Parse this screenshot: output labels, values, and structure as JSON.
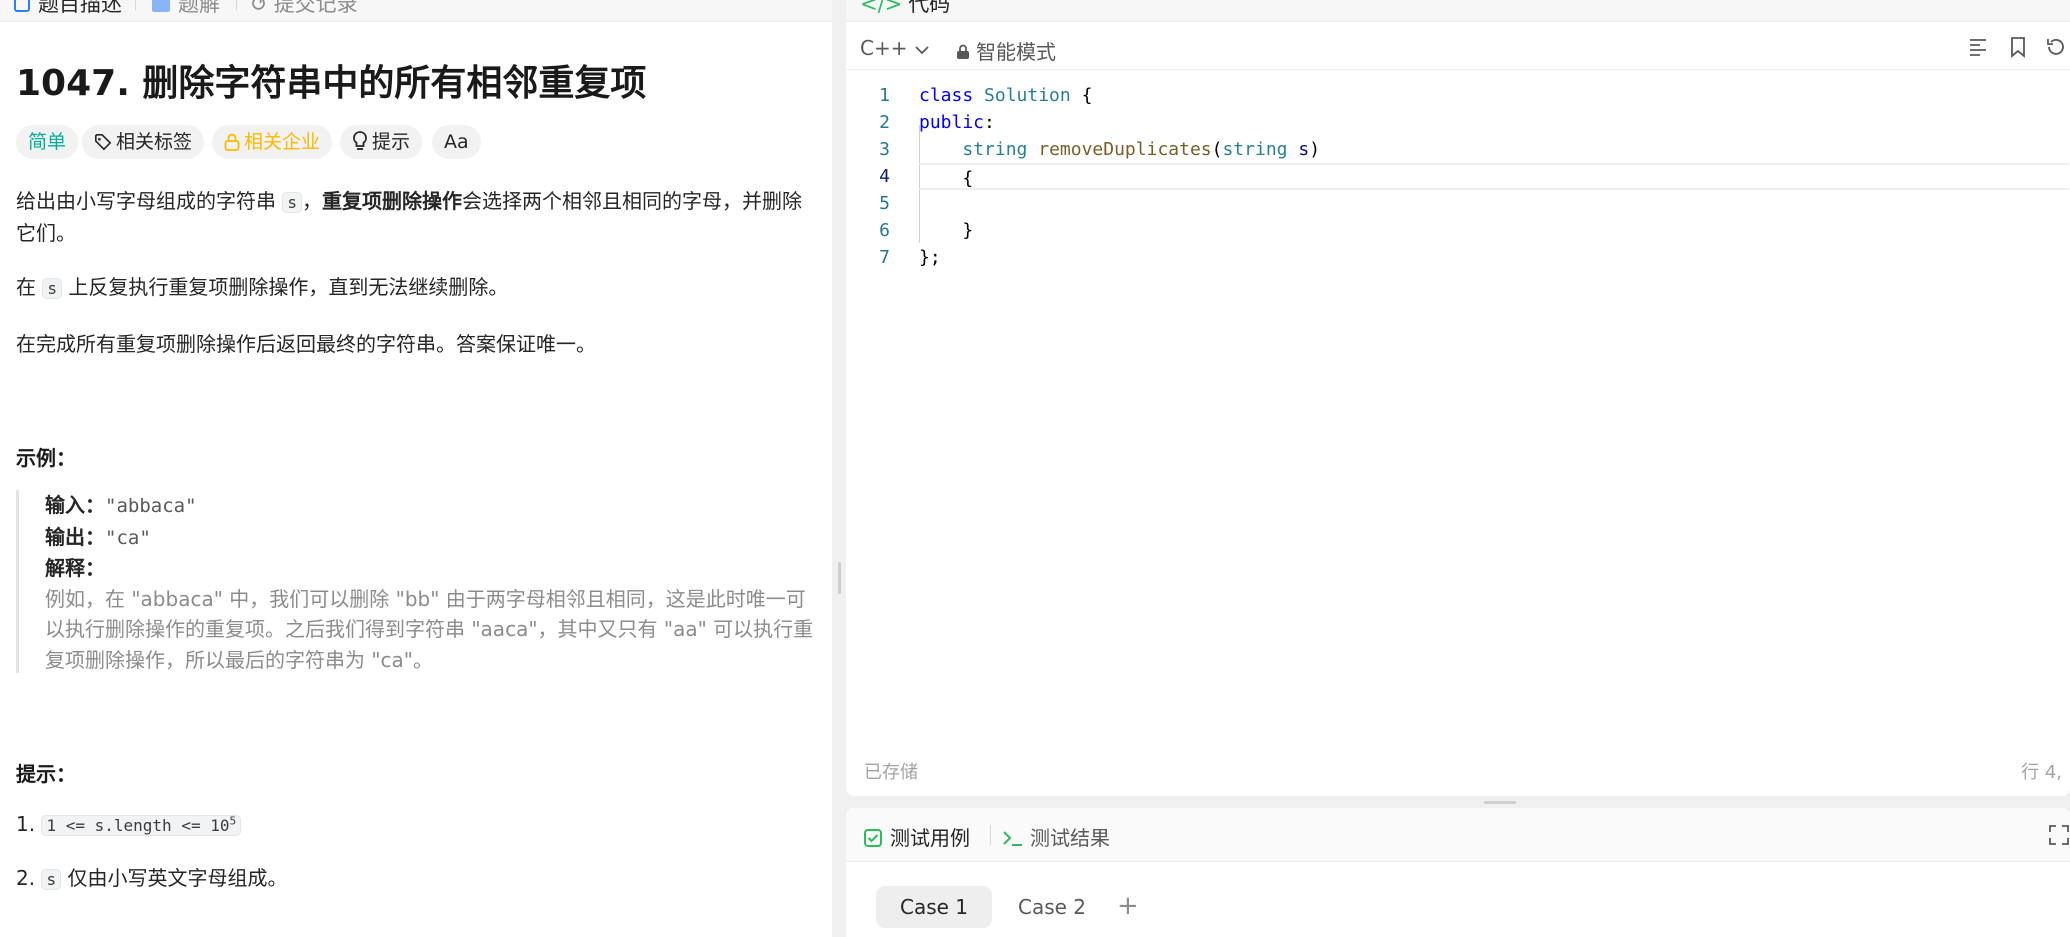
{
  "left_tabs": [
    "题目描述",
    "题解",
    "提交记录"
  ],
  "problem": {
    "title": "1047. 删除字符串中的所有相邻重复项",
    "tags": {
      "difficulty": "简单",
      "related_tags": "相关标签",
      "related_companies": "相关企业",
      "hint": "提示",
      "translate": "Aa"
    },
    "desc1_a": "给出由小写字母组成的字符串 ",
    "desc1_code": "s",
    "desc1_b": "，",
    "desc1_bold": "重复项删除操作",
    "desc1_c": "会选择两个相邻且相同的字母，并删除它们。",
    "desc2_a": "在 ",
    "desc2_code": "s",
    "desc2_b": " 上反复执行重复项删除操作，直到无法继续删除。",
    "desc3": "在完成所有重复项删除操作后返回最终的字符串。答案保证唯一。",
    "example_heading": "示例：",
    "example": {
      "input_label": "输入：",
      "input_value": "\"abbaca\"",
      "output_label": "输出：",
      "output_value": "\"ca\"",
      "explain_label": "解释：",
      "explain_text": "例如，在 \"abbaca\" 中，我们可以删除 \"bb\" 由于两字母相邻且相同，这是此时唯一可以执行删除操作的重复项。之后我们得到字符串 \"aaca\"，其中又只有 \"aa\" 可以执行重复项删除操作，所以最后的字符串为 \"ca\"。"
    },
    "hints_heading": "提示：",
    "hint1_num": "1.",
    "hint1_code": "1 <= s.length <= 10",
    "hint1_sup": "5",
    "hint2_num": "2.",
    "hint2_code": "s",
    "hint2_text": " 仅由小写英文字母组成。"
  },
  "editor": {
    "tab_title": "代码",
    "language": "C++",
    "mode": "智能模式",
    "line_numbers": [
      "1",
      "2",
      "3",
      "4",
      "5",
      "6",
      "7"
    ],
    "saved_status": "已存储",
    "cursor_position": "行 4,"
  },
  "tests": {
    "tab_testcase": "测试用例",
    "tab_result": "测试结果",
    "cases": [
      "Case 1",
      "Case 2"
    ],
    "add": "+"
  },
  "colors": {
    "accent_blue": "#2d7ff9",
    "easy": "#00af9b",
    "company": "#ffb800",
    "check_green": "#2cbb5d"
  }
}
